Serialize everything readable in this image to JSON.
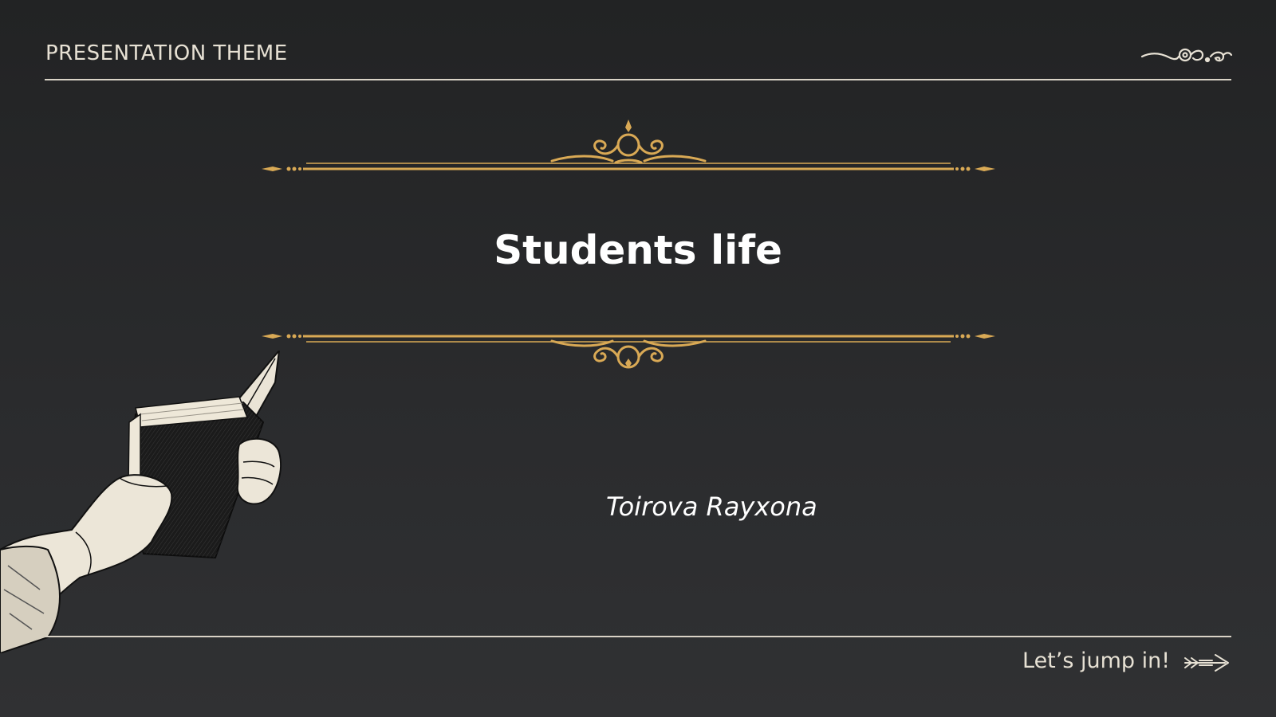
{
  "header": {
    "title": "PRESENTATION THEME"
  },
  "main": {
    "title": "Students life",
    "author": "Toirova Rayxona"
  },
  "footer": {
    "cta_label": "Let’s jump in!"
  },
  "colors": {
    "background": "#27282a",
    "gold": "#d9a955",
    "line": "#d9d3c6",
    "text": "#ffffff"
  },
  "icons": {
    "header": "flourish-icon",
    "ornament": "scroll-ornament-icon",
    "cta": "arrow-icon",
    "illustration": "hand-holding-book-illustration"
  }
}
